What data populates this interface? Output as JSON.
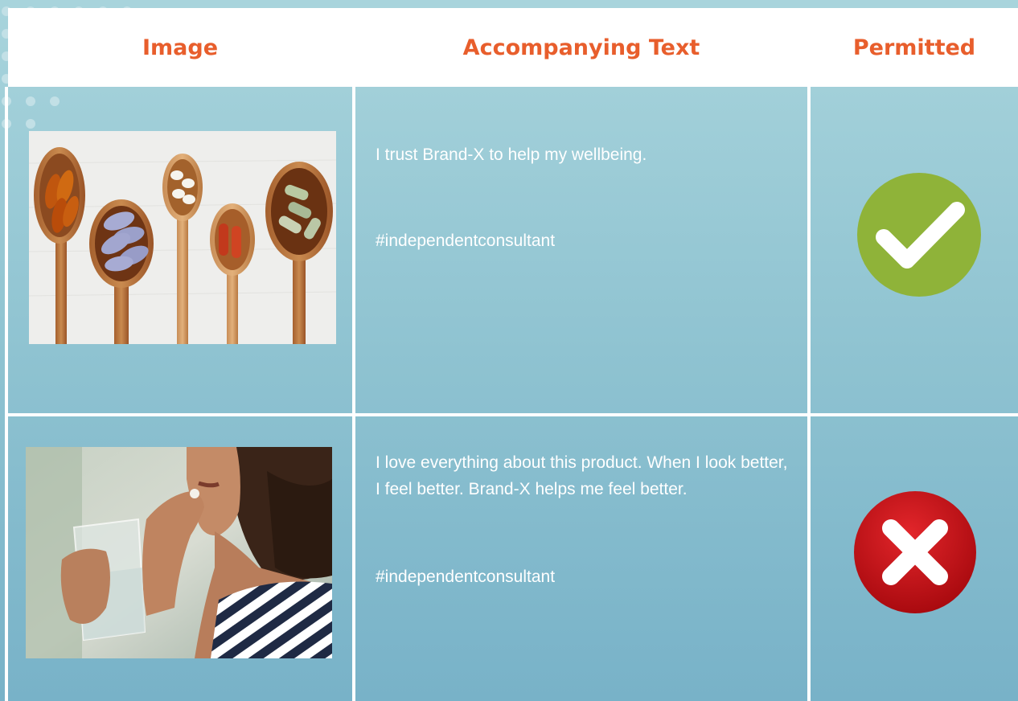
{
  "table": {
    "headers": {
      "image": "Image",
      "text": "Accompanying Text",
      "permitted": "Permitted"
    },
    "rows": [
      {
        "image_icon": "vitamin-spoons-photo",
        "text": "I trust Brand-X to help my wellbeing.",
        "hashtag": "#independentconsultant",
        "permitted_icon": "checkmark-icon",
        "permitted": true
      },
      {
        "image_icon": "woman-taking-pill-photo",
        "text": "I love everything about this product. When I look better, I feel better. Brand-X helps me feel better.",
        "hashtag": "#independentconsultant",
        "permitted_icon": "cross-icon",
        "permitted": false
      }
    ]
  },
  "colors": {
    "header_text": "#e85e2c",
    "check_green": "#8fb339",
    "cross_red": "#c8141c",
    "background_top": "#a8d4dc",
    "background_bottom": "#78b2c8"
  }
}
